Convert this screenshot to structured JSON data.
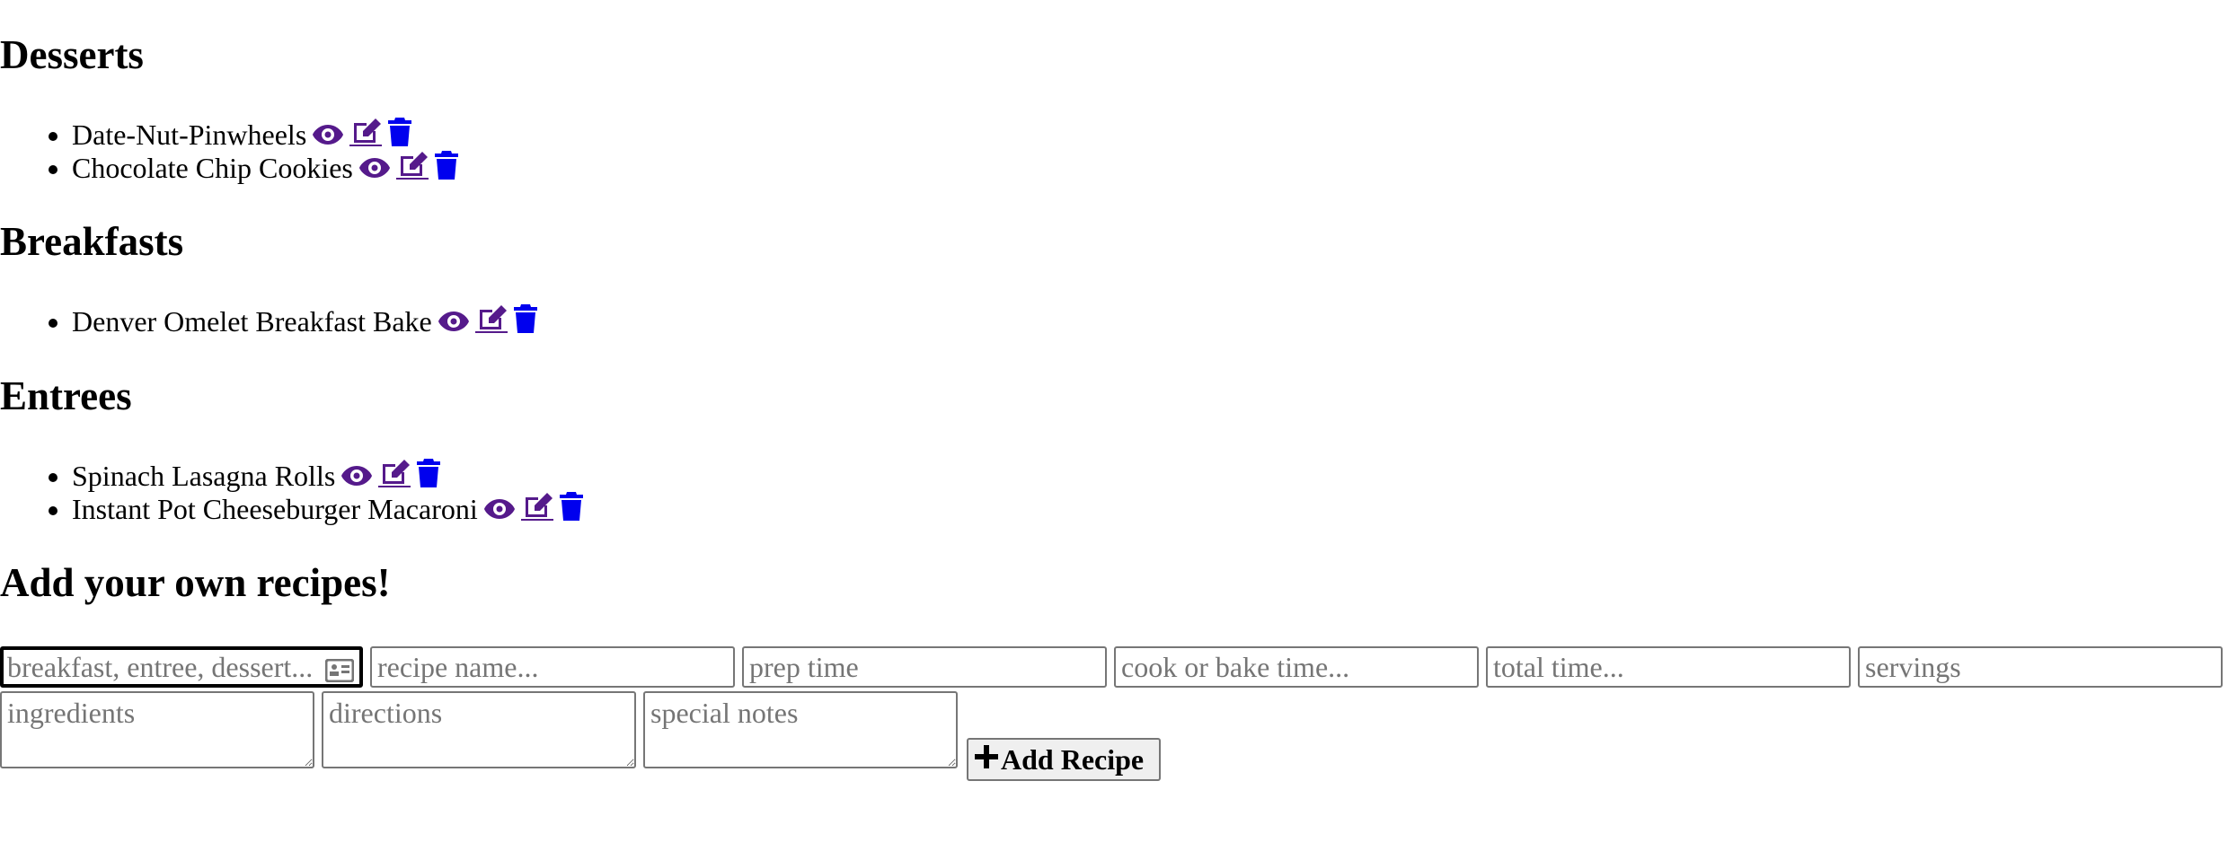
{
  "sections": [
    {
      "heading": "Desserts",
      "recipes": [
        "Date-Nut-Pinwheels",
        "Chocolate Chip Cookies"
      ]
    },
    {
      "heading": "Breakfasts",
      "recipes": [
        "Denver Omelet Breakfast Bake"
      ]
    },
    {
      "heading": "Entrees",
      "recipes": [
        "Spinach Lasagna Rolls",
        "Instant Pot Cheeseburger Macaroni"
      ]
    }
  ],
  "recipe_actions": {
    "view_icon": "eye-icon",
    "edit_icon": "edit-icon",
    "delete_icon": "trash-icon"
  },
  "form": {
    "heading": "Add your own recipes!",
    "category_placeholder": "breakfast, entree, dessert...",
    "category_value": "",
    "name_placeholder": "recipe name...",
    "name_value": "",
    "prep_placeholder": "prep time",
    "prep_value": "",
    "cook_placeholder": "cook or bake time...",
    "cook_value": "",
    "total_placeholder": "total time...",
    "total_value": "",
    "servings_placeholder": "servings",
    "servings_value": "",
    "ingredients_placeholder": "ingredients",
    "directions_placeholder": "directions",
    "notes_placeholder": "special notes",
    "submit_label": "Add Recipe",
    "submit_icon": "plus-icon"
  },
  "colors": {
    "visited_link": "#551a8b",
    "link": "#0000ee"
  }
}
